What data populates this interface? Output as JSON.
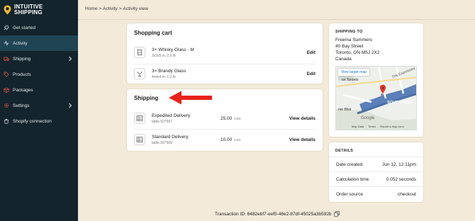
{
  "app": {
    "brand_line1": "INTUITIVE",
    "brand_line2": "SHIPPING"
  },
  "sidebar": {
    "items": [
      {
        "label": "Get started",
        "icon": "rocket-icon"
      },
      {
        "label": "Activity",
        "icon": "activity-icon",
        "active": true
      },
      {
        "label": "Shipping",
        "icon": "truck-icon",
        "has_children": true
      },
      {
        "label": "Products",
        "icon": "tag-icon"
      },
      {
        "label": "Packages",
        "icon": "box-icon"
      },
      {
        "label": "Settings",
        "icon": "gear-icon",
        "has_children": true
      },
      {
        "label": "Shopify connection",
        "icon": "shopify-icon"
      }
    ]
  },
  "breadcrumb": {
    "home": "Home",
    "activity": "Activity",
    "current": "Activity view",
    "sep": ">"
  },
  "cart": {
    "title": "Shopping cart",
    "items": [
      {
        "name": "3× Whisky Glass - M",
        "dims": "3x3x5 in, 0.9 lb",
        "action": "Edit"
      },
      {
        "name": "3× Brandy Glass",
        "dims": "4x4x4 in, 1.1 lb",
        "action": "Edit"
      }
    ]
  },
  "shipping": {
    "title": "Shipping",
    "rows": [
      {
        "name": "Expedited Delivery",
        "table": "table.507567",
        "price": "25.00",
        "currency": "USD",
        "action": "View details"
      },
      {
        "name": "Standard Delivery",
        "table": "table.507569",
        "price": "10.00",
        "currency": "USD",
        "action": "View details"
      }
    ]
  },
  "ship_to": {
    "title": "SHIPPING TO",
    "name": "Freema Summers",
    "street": "40 Bay Street",
    "city": "Toronto, ON M5J 2X2",
    "country": "Canada",
    "map": {
      "larger_map": "View larger map",
      "labels": {
        "toronto": "on Toronto",
        "expressway": "The Expresswa",
        "south_core": "SOUTH CORE",
        "blvd": "ner Blvd"
      },
      "footer": [
        "Map Data",
        "Terms",
        "Report a map error"
      ],
      "google": "Google"
    }
  },
  "details": {
    "title": "DETAILS",
    "rows": [
      {
        "label": "Date created",
        "value": "Jun 12, 12:11pm"
      },
      {
        "label": "Calculation time",
        "value": "0.052 seconds"
      },
      {
        "label": "Order source",
        "value": "checkout"
      }
    ]
  },
  "footer": {
    "transaction": "Transaction ID: 6482ebf7-eef5-46e2-87df-45025a3b592b"
  },
  "colors": {
    "sidebar": "#13242c",
    "active": "#1f4454",
    "background": "#f3ead9",
    "arrow": "#e8231b",
    "pin": "#f0b72a"
  }
}
